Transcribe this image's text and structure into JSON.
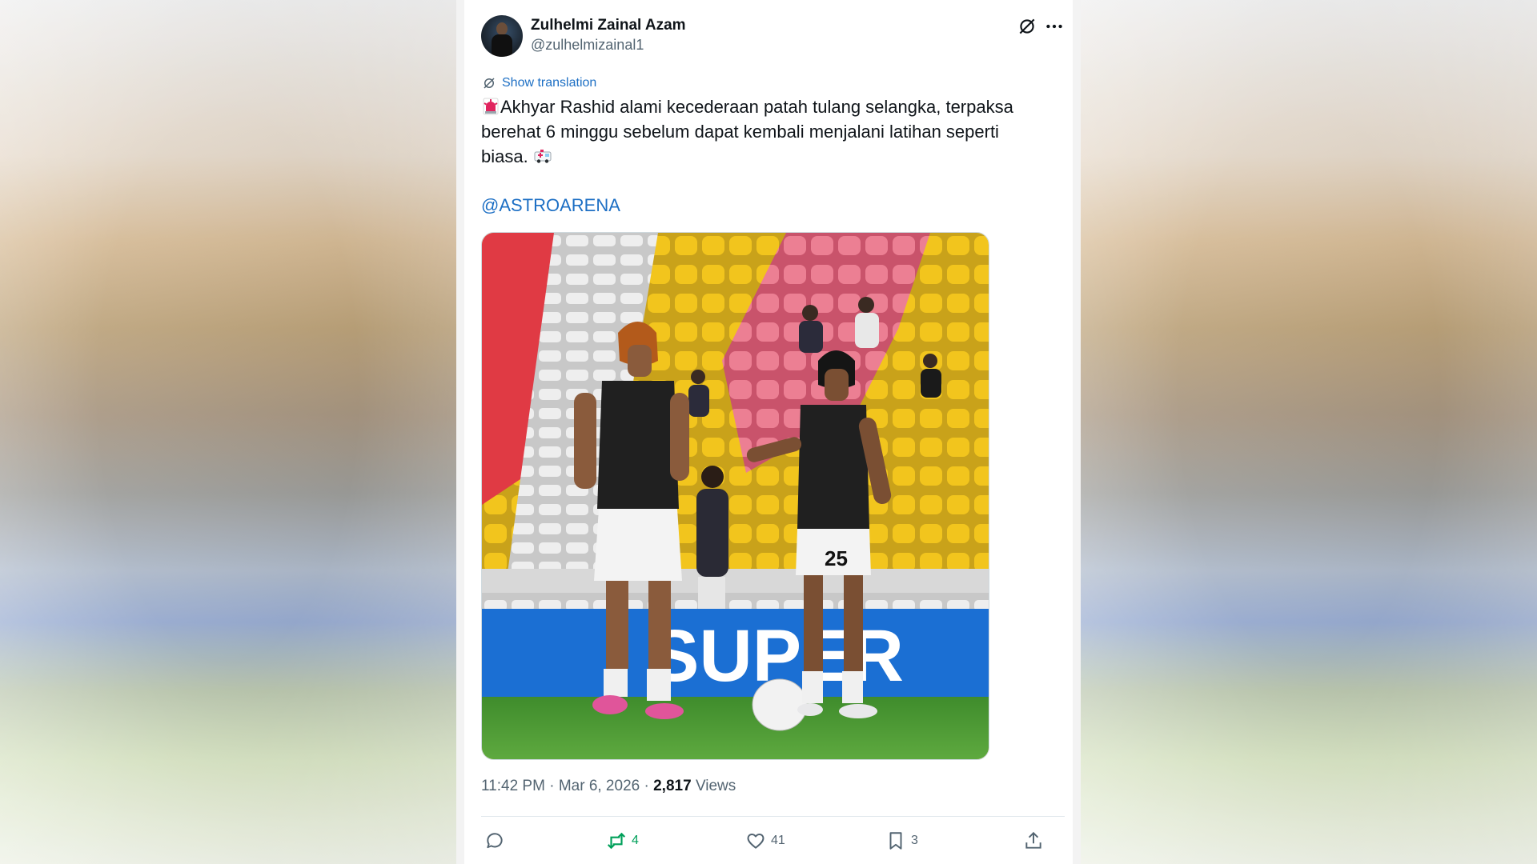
{
  "author": {
    "name": "Zulhelmi Zainal Azam",
    "handle": "@zulhelmizainal1"
  },
  "translate_label": "Show translation",
  "tweet": {
    "text": "Akhyar Rashid alami kecederaan patah tulang selangka, terpaksa berehat 6 minggu sebelum dapat kembali menjalani latihan seperti biasa.",
    "mention": "@ASTROARENA",
    "emoji_start": "rotating-light",
    "emoji_end": "ambulance"
  },
  "media": {
    "banner_text": "SUPER",
    "player_number": "25"
  },
  "meta": {
    "time": "11:42 PM",
    "separator": "·",
    "date": "Mar 6, 2026",
    "views_count": "2,817",
    "views_label": "Views"
  },
  "actions": {
    "replies": "",
    "reposts": "4",
    "likes": "41",
    "bookmarks": "3"
  },
  "colors": {
    "link": "#1d6fc4",
    "repost_active": "#00a05a",
    "text_primary": "#0f1419",
    "text_secondary": "#536471"
  }
}
